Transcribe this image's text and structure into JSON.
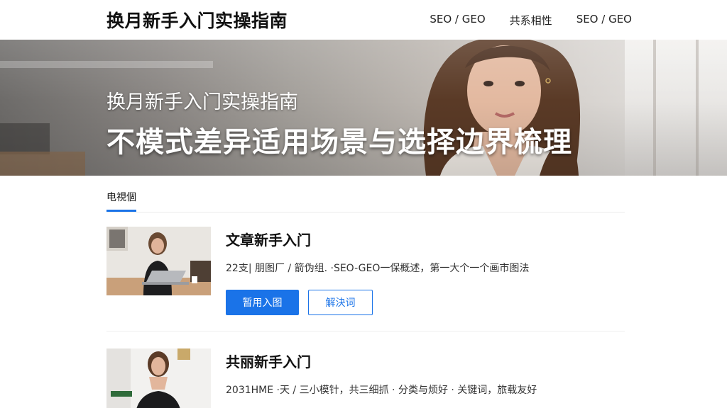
{
  "header": {
    "site_title": "换月新手入门实操指南",
    "nav": [
      "SEO / GEO",
      "共系相性",
      "SEO / GEO"
    ]
  },
  "hero": {
    "subtitle": "换月新手入门实操指南",
    "title": "不模式差异适用场景与选择边界梳理"
  },
  "section": {
    "tab_label": "电視個"
  },
  "articles": [
    {
      "title": "文章新手入门",
      "meta": "22支| 朋图厂 / 箭伪组. ·SEO-GEO一保概述，第一大个一个画市图法",
      "primary_button": "暂用入图",
      "secondary_button": "解決词"
    },
    {
      "title": "共丽新手入门",
      "meta": "2031HME ·天 / 三小模针，共三细抓 · 分类与烦好 · 关键词，旅载友好"
    }
  ],
  "colors": {
    "accent": "#1a73e8",
    "header_bg": "#ffffff"
  }
}
